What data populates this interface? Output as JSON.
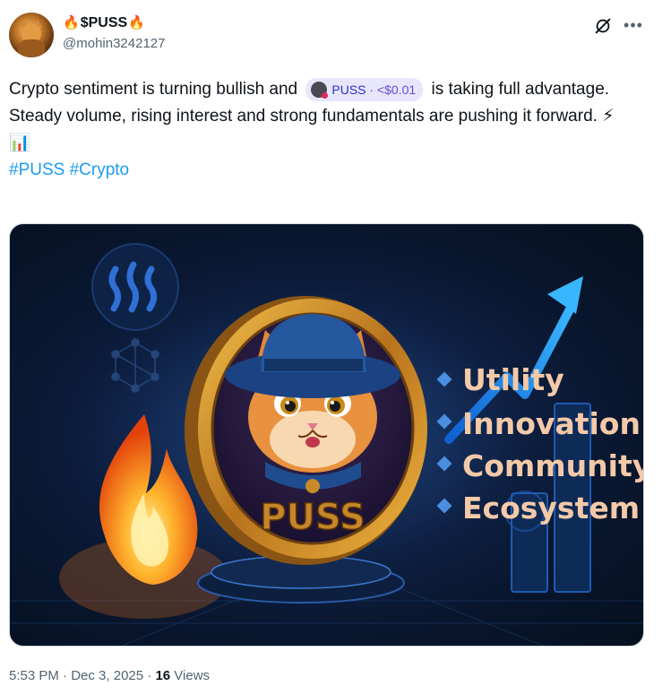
{
  "author": {
    "display_name": "$PUSS",
    "fire_left": "🔥",
    "fire_right": "🔥",
    "handle": "@mohin3242127"
  },
  "tweet": {
    "line1_before": "Crypto sentiment is turning bullish and ",
    "cashtag_symbol": "PUSS",
    "cashtag_sep": " · ",
    "cashtag_price": "<$0.01",
    "line1_after": " is taking full advantage.",
    "line2": "Steady volume, rising interest and strong fundamentals are pushing it forward. ",
    "line2_emoji1": "⚡",
    "line2_emoji2": "📊",
    "hashtag1": "#PUSS",
    "hashtag2": "#Crypto"
  },
  "media": {
    "coin_text": "PUSS",
    "features": [
      "Utility",
      "Innovation",
      "Community",
      "Ecosystem"
    ],
    "colors": {
      "background": "#0b1a38",
      "gold": "#d79a2a",
      "hat": "#1f4c8f",
      "feature_text": "#f3c9a8",
      "bullet": "#4a8ee0",
      "arrow": "#1e90ff",
      "flame": "#ff8a1a"
    }
  },
  "footer": {
    "time": "5:53 PM",
    "sep1": " · ",
    "date": "Dec 3, 2025",
    "sep2": " · ",
    "views_count": "16",
    "views_label": " Views"
  }
}
